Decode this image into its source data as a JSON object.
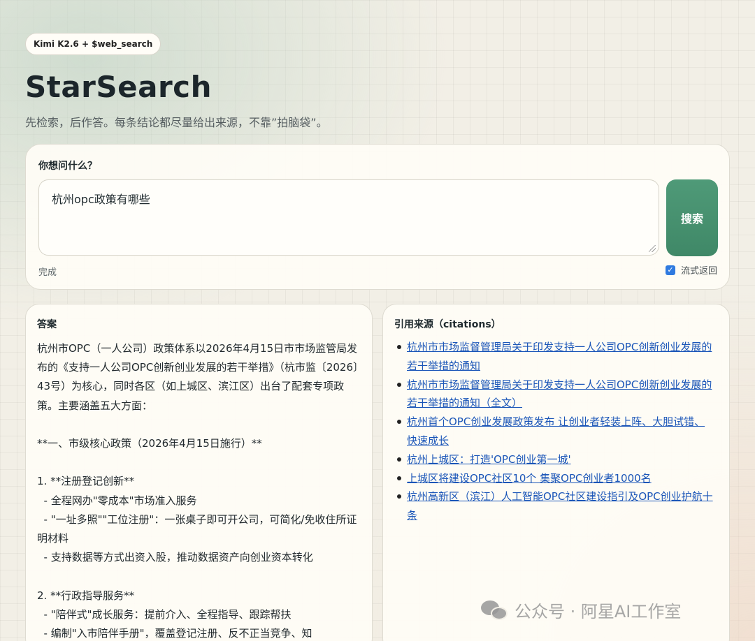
{
  "badge": "Kimi K2.6 + $web_search",
  "app": {
    "title": "StarSearch",
    "subtitle": "先检索，后作答。每条结论都尽量给出来源，不靠”拍脑袋”。"
  },
  "ask": {
    "label": "你想问什么？",
    "query": "杭州opc政策有哪些",
    "button": "搜索",
    "status": "完成",
    "stream_label": "流式返回",
    "stream_checked": true
  },
  "answer": {
    "title": "答案",
    "body": "杭州市OPC（一人公司）政策体系以2026年4月15日市市场监管局发布的《支持一人公司OPC创新创业发展的若干举措》（杭市监〔2026〕43号）为核心，同时各区（如上城区、滨江区）出台了配套专项政策。主要涵盖五大方面：\n\n**一、市级核心政策（2026年4月15日施行）**\n\n1. **注册登记创新**\n  - 全程网办\"零成本\"市场准入服务\n  - \"一址多照\"\"工位注册\"：一张桌子即可开公司，可简化/免收住所证明材料\n  - 支持数据等方式出资入股，推动数据资产向创业资本转化\n\n2. **行政指导服务**\n  - \"陪伴式\"成长服务：提前介入、全程指导、跟踪帮扶\n  - 编制\"入市陪伴手册\"，覆盖登记注册、反不正当竞争、知"
  },
  "citations": {
    "title": "引用来源（citations）",
    "items": [
      "杭州市市场监督管理局关于印发支持一人公司OPC创新创业发展的若干举措的通知",
      "杭州市市场监督管理局关于印发支持一人公司OPC创新创业发展的若干举措的通知（全文）",
      "杭州首个OPC创业发展政策发布 让创业者轻装上阵、大胆试错、快速成长",
      "杭州上城区：打造'OPC创业第一城'",
      "上城区将建设OPC社区10个 集聚OPC创业者1000名",
      "杭州高新区（滨江）人工智能OPC社区建设指引及OPC创业护航十条"
    ]
  },
  "watermark": "公众号 · 阿星AI工作室",
  "icons": {
    "checkbox": "checkmark-icon",
    "watermark": "wechat-icon"
  },
  "colors": {
    "accent": "#4a9673",
    "link": "#1a55b8",
    "checkbox": "#2f7ae0"
  }
}
